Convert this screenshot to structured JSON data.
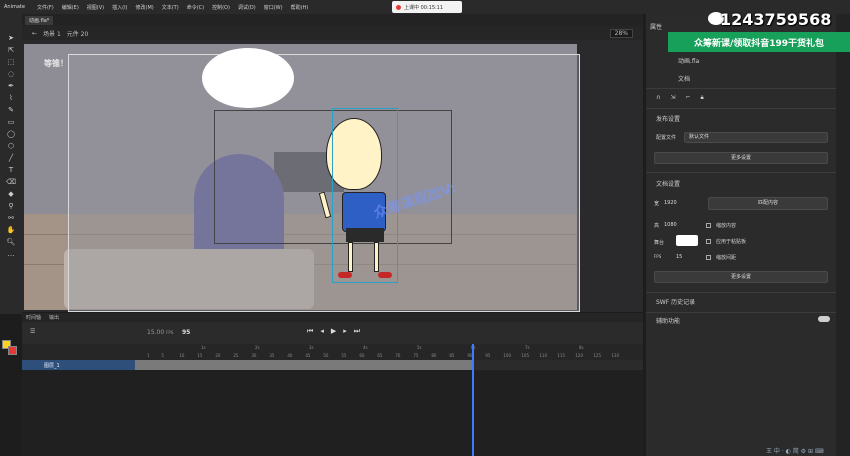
{
  "app": {
    "name": "Animate"
  },
  "menu": [
    "文件(F)",
    "编辑(E)",
    "视图(V)",
    "插入(I)",
    "修改(M)",
    "文本(T)",
    "命令(C)",
    "控制(O)",
    "调试(D)",
    "窗口(W)",
    "帮助(H)"
  ],
  "live": {
    "label": "上课中 00:15:11"
  },
  "doc_tab": {
    "label": "动画.fla*"
  },
  "scene": {
    "name": "场景 1",
    "symbol": "元件 20",
    "zoom": "28%"
  },
  "stage": {
    "bubble_label": "等锥！",
    "watermark": "众筹课程加V:"
  },
  "timeline": {
    "tabs": [
      "时间轴",
      "输出"
    ],
    "fps": "15.00",
    "fps_unit": "FPS",
    "current_frame": "95",
    "ruler_numbers": [
      "1",
      "5",
      "10",
      "15",
      "20",
      "25",
      "30",
      "35",
      "40",
      "45",
      "50",
      "55",
      "60",
      "65",
      "70",
      "75",
      "80",
      "85",
      "90",
      "95",
      "100",
      "105",
      "110",
      "115",
      "120",
      "125",
      "130"
    ],
    "ruler_seconds": [
      "1s",
      "2s",
      "3s",
      "4s",
      "5s",
      "6s",
      "7s",
      "8s"
    ],
    "layer_name": "图层_1"
  },
  "props": {
    "header": "属性",
    "doc_type": "动画.fla",
    "doc_label": "文档",
    "publish_section": "发布设置",
    "config_label": "配置文件",
    "config_value": "默认文件",
    "more_settings": "更多设置",
    "doc_settings_section": "文档设置",
    "width_label": "宽",
    "width_value": "1920",
    "height_label": "高",
    "height_value": "1080",
    "match_content": "匹配内容",
    "scale_content": "缩放内容",
    "stage_label": "舞台",
    "apply_pasteboard": "应用于粘贴板",
    "fps_label": "FPS",
    "fps_value": "15",
    "scale_spans": "缩放间距",
    "more_settings_2": "更多设置",
    "swf_history": "SWF 历史记录",
    "accessibility": "辅助功能"
  },
  "promo": {
    "phone": "1243759568",
    "banner": "众筹新课/领取抖音199干货礼包"
  },
  "taskbar": {
    "text": "王 中 · ◐ 简 ⚙ ⊞ ⌨"
  },
  "colors": {
    "accent": "#3a7bff",
    "layer": "#2e4f79",
    "promo_green": "#16a05a"
  }
}
